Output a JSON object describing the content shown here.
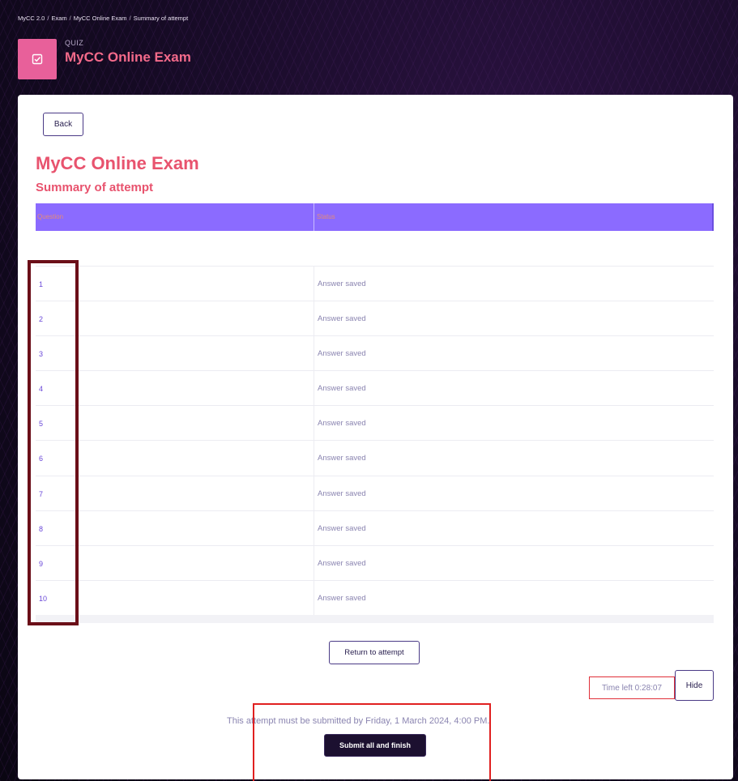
{
  "breadcrumb": [
    {
      "label": "MyCC 2.0",
      "sep": "/"
    },
    {
      "label": "Exam",
      "sep": "/"
    },
    {
      "label": "MyCC Online Exam",
      "sep": "/"
    },
    {
      "label": "Summary of attempt",
      "sep": ""
    }
  ],
  "header": {
    "kicker": "QUIZ",
    "title": "MyCC Online Exam",
    "icon": "quiz-checkbox-icon"
  },
  "card": {
    "back_label": "Back",
    "title": "MyCC Online Exam",
    "subtitle": "Summary of attempt"
  },
  "table": {
    "columns": [
      "Question",
      "Status"
    ],
    "rows": [
      {
        "question": "1",
        "status": "Answer saved"
      },
      {
        "question": "2",
        "status": "Answer saved"
      },
      {
        "question": "3",
        "status": "Answer saved"
      },
      {
        "question": "4",
        "status": "Answer saved"
      },
      {
        "question": "5",
        "status": "Answer saved"
      },
      {
        "question": "6",
        "status": "Answer saved"
      },
      {
        "question": "7",
        "status": "Answer saved"
      },
      {
        "question": "8",
        "status": "Answer saved"
      },
      {
        "question": "9",
        "status": "Answer saved"
      },
      {
        "question": "10",
        "status": "Answer saved"
      }
    ]
  },
  "actions": {
    "return_label": "Return to attempt",
    "timer_text": "Time left 0:28:07",
    "hide_label": "Hide",
    "deadline_text": "This attempt must be submitted by Friday, 1 March 2024, 4:00 PM.",
    "submit_label": "Submit all and finish"
  },
  "colors": {
    "accent": "#8b6bff",
    "title": "#e8536e",
    "header_icon_bg": "#e8609a",
    "submit_bg": "#1c1030",
    "annotation_dark": "#6b0f18",
    "annotation_red": "#e02020"
  }
}
